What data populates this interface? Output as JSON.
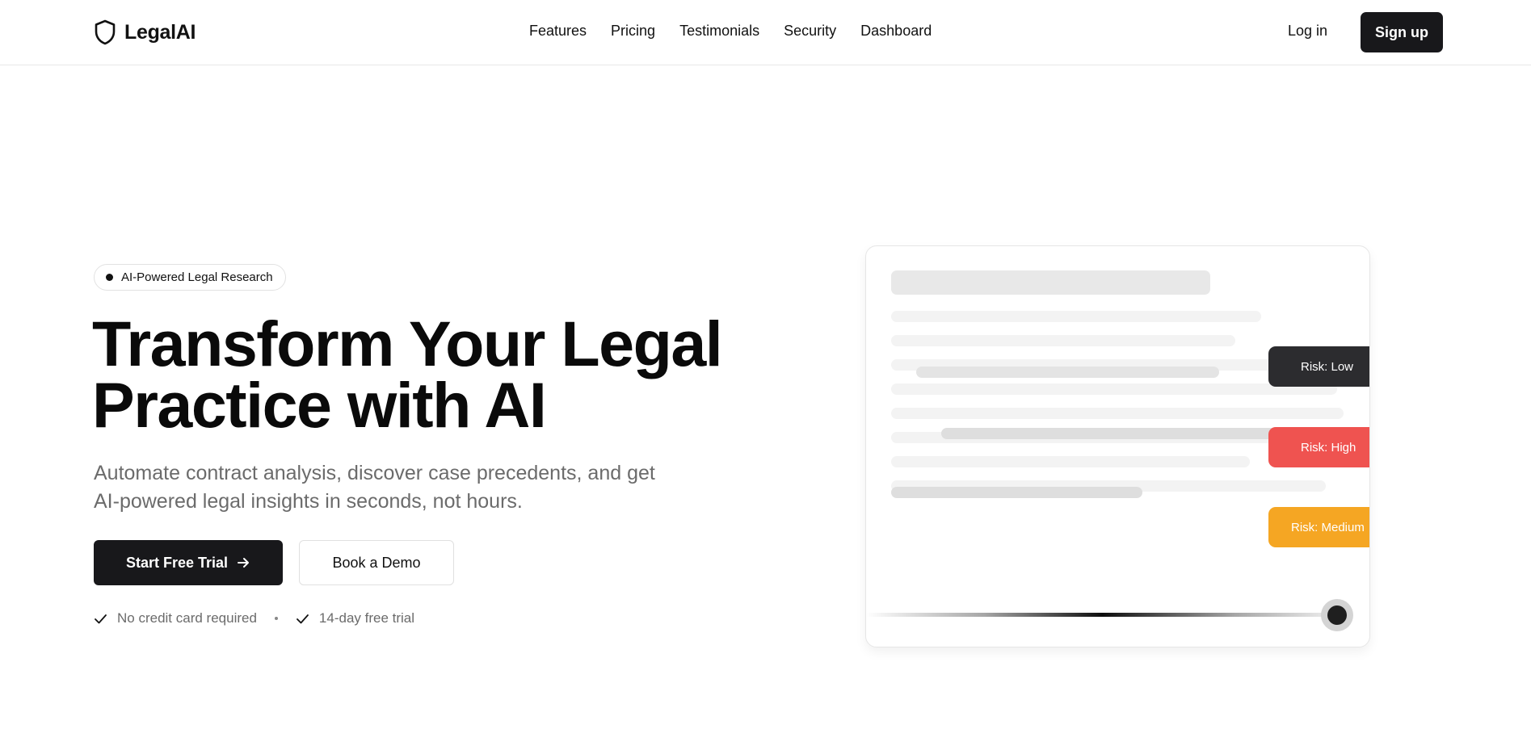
{
  "brand": {
    "name": "LegalAI",
    "icon": "shield-icon"
  },
  "nav": {
    "items": [
      "Features",
      "Pricing",
      "Testimonials",
      "Security",
      "Dashboard"
    ],
    "login_label": "Log in",
    "signup_label": "Sign up"
  },
  "hero": {
    "badge": "AI-Powered Legal Research",
    "title_line1": "Transform Your Legal",
    "title_line2": "Practice with AI",
    "subtitle_line1": "Automate contract analysis, discover case precedents, and get",
    "subtitle_line2": "AI-powered legal insights in seconds, not hours.",
    "primary_cta": "Start Free Trial",
    "secondary_cta": "Book a Demo",
    "checks": [
      "No credit card required",
      "14-day free trial"
    ]
  },
  "preview": {
    "risk_labels": [
      "Risk: Low",
      "Risk: High",
      "Risk: Medium"
    ]
  },
  "colors": {
    "primary": "#18181b",
    "risk_low": "#2c2c2f",
    "risk_high": "#ef5350",
    "risk_medium": "#f5a623",
    "muted_text": "#6b6b6b"
  }
}
